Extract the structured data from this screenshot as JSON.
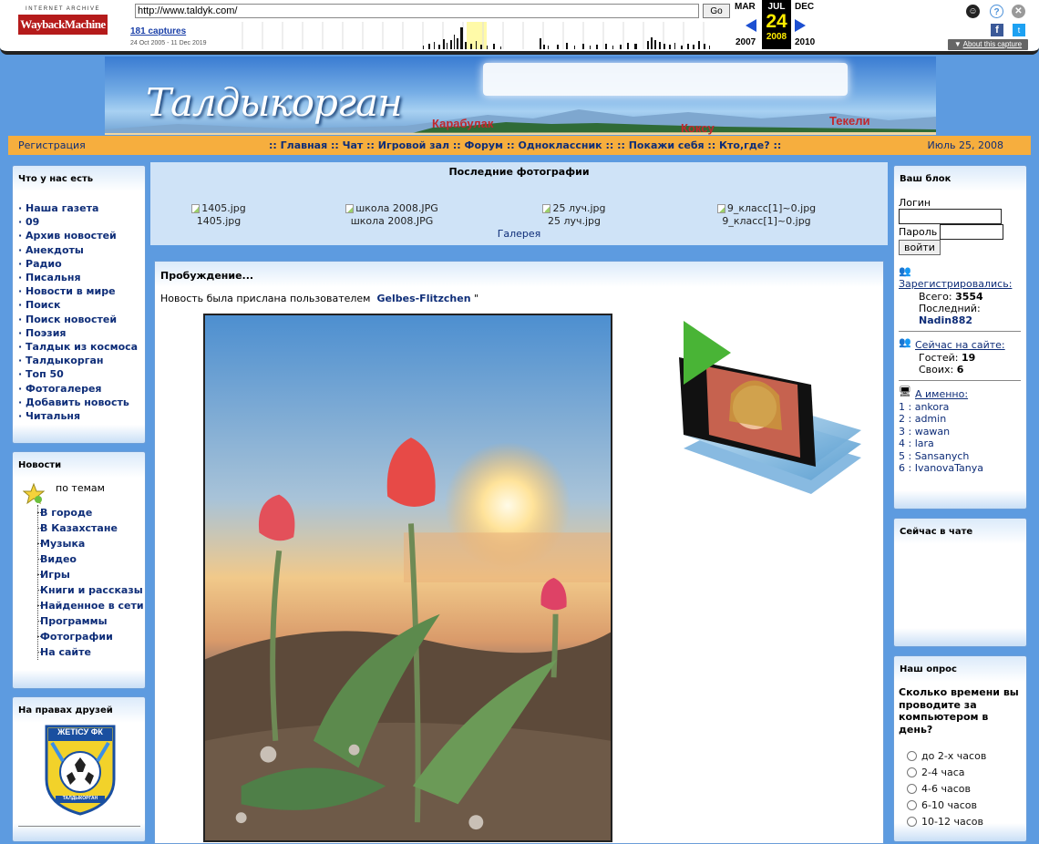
{
  "wayback": {
    "logo_top": "INTERNET ARCHIVE",
    "logo_main": "WaybackMachine",
    "url": "http://www.taldyk.com/",
    "go_label": "Go",
    "captures": "181 captures",
    "range": "24 Oct 2005 - 11 Dec 2019",
    "prev_month": "MAR",
    "prev_year": "2007",
    "cur_month": "JUL",
    "cur_day": "24",
    "cur_year": "2008",
    "next_month": "DEC",
    "next_year": "2010",
    "about": "About this capture"
  },
  "site": {
    "logo": "Талдыкорган",
    "towns": [
      "Карабулак",
      "Коксу",
      "Текели"
    ]
  },
  "nav": {
    "register": "Регистрация",
    "links": ":: Главная :: Чат :: Игровой зал :: Форум :: Одноклассник :: :: Покажи себя :: Кто,где? ::",
    "date": "Июль 25, 2008"
  },
  "left": {
    "whats_here_title": "Что у нас есть",
    "menu": [
      "Наша газета",
      "09",
      "Архив новостей",
      "Анекдоты",
      "Радио",
      "Писальня",
      "Новости в мире",
      "Поиск",
      "Поиск новостей",
      "Поэзия",
      "Талдык из космоса",
      "Талдыкорган",
      "Топ 50",
      "Фотогалерея",
      "Добавить новость",
      "Читальня"
    ],
    "news_title": "Новости",
    "news_subtitle": "по темам",
    "news_topics": [
      "В городе",
      "В Казахстане",
      "Музыка",
      "Видео",
      "Игры",
      "Книги и рассказы",
      "Найденное в сети",
      "Программы",
      "Фотографии",
      "На сайте"
    ],
    "friends_title": "На правах друзей",
    "friends_logo_text": "ЖЕТІСУ ФК",
    "friends_logo_bottom": "ТАЛДЫКОРГАН"
  },
  "center": {
    "gallery_title": "Последние фотографии",
    "thumbs": [
      {
        "alt": "1405.jpg",
        "caption": "1405.jpg"
      },
      {
        "alt": "школа 2008.JPG",
        "caption": "школа 2008.JPG"
      },
      {
        "alt": "25 луч.jpg",
        "caption": "25 луч.jpg"
      },
      {
        "alt": "9_класс[1]~0.jpg",
        "caption": "9_класс[1]~0.jpg"
      }
    ],
    "gallery_link": "Галерея",
    "article_title": "Пробуждение...",
    "article_meta_prefix": "Новость была прислана пользователем",
    "article_author": "Gelbes-Flitzchen",
    "article_meta_suffix": "\""
  },
  "right": {
    "block_title": "Ваш блок",
    "login_label": "Логин",
    "password_label": "Пароль",
    "login_button": "войти",
    "registered_label": "Зарегистрировались:",
    "total_label": "Всего:",
    "total_value": "3554",
    "last_label": "Последний:",
    "last_value": "Nadin882",
    "online_label": "Сейчас на сайте:",
    "guests_label": "Гостей:",
    "guests_value": "19",
    "members_label": "Своих:",
    "members_value": "6",
    "names_label": "А именно:",
    "online_users": [
      "1 : ankora",
      "2 : admin",
      "3 : wawan",
      "4 : lara",
      "5 : Sansanych",
      "6 : IvanovaTanya"
    ],
    "chat_title": "Сейчас в чате",
    "poll_title": "Наш опрос",
    "poll_question": "Сколько времени вы проводите за компьютером в день?",
    "poll_options": [
      "до 2-х часов",
      "2-4 часа",
      "4-6 часов",
      "6-10 часов",
      "10-12 часов"
    ]
  }
}
